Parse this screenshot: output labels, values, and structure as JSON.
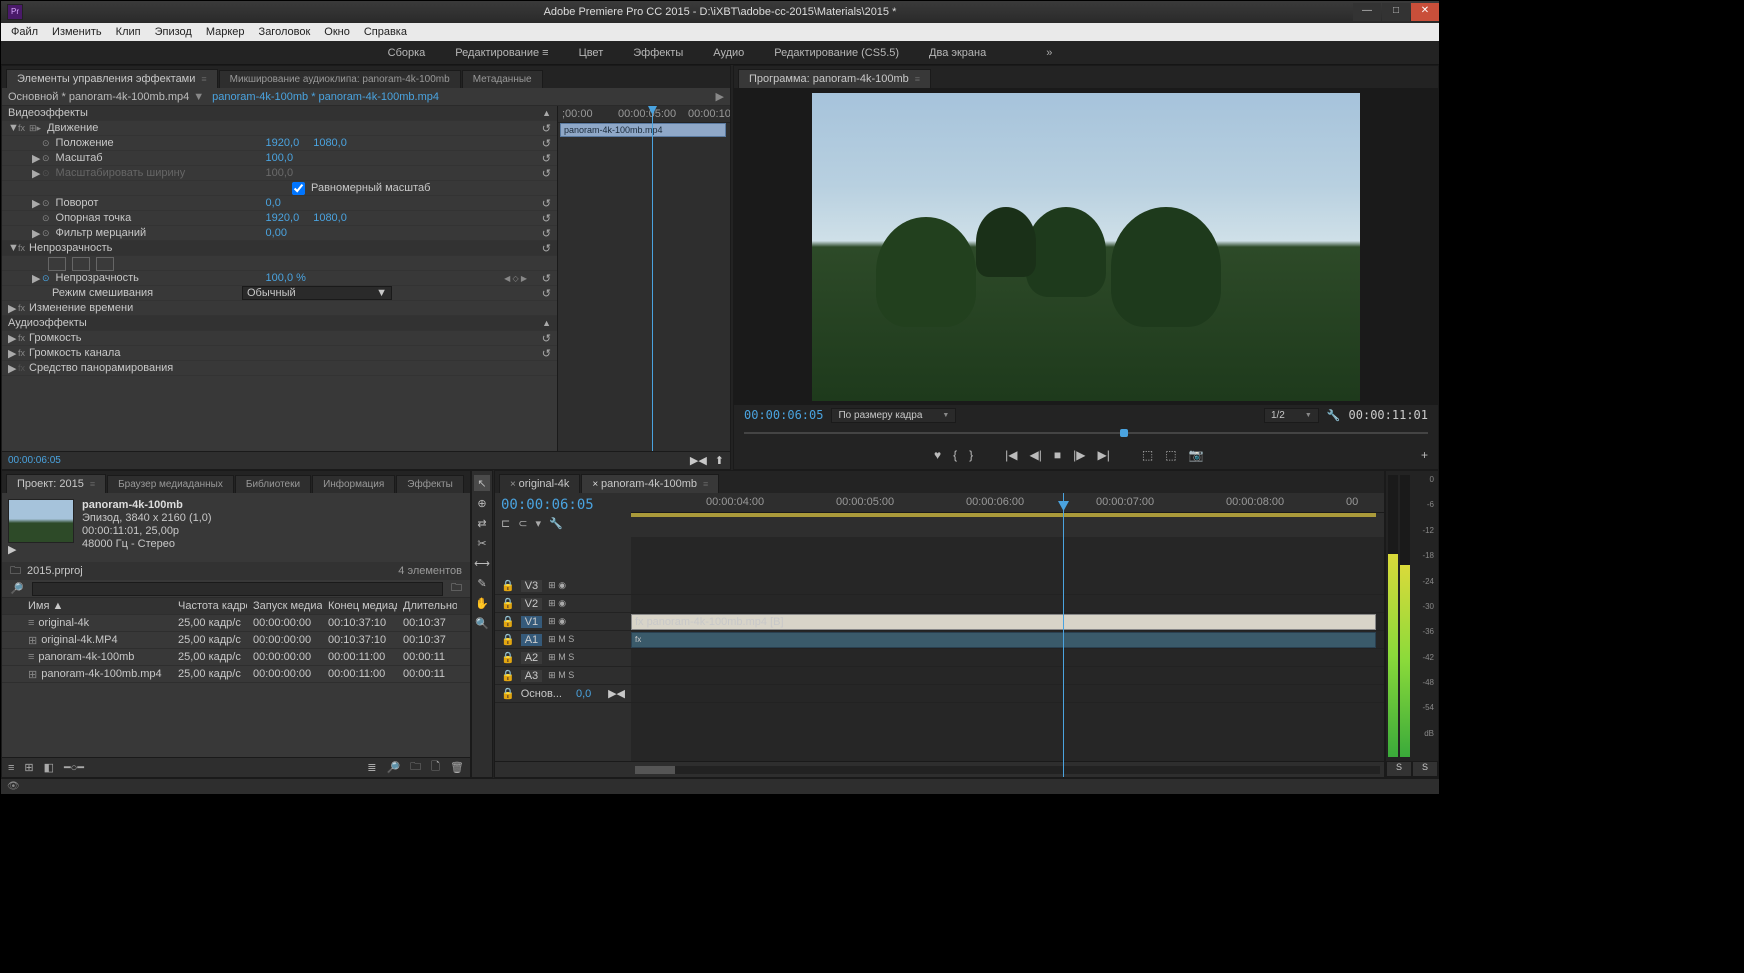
{
  "title": "Adobe Premiere Pro CC 2015 - D:\\iXBT\\adobe-cc-2015\\Materials\\2015 *",
  "menu": [
    "Файл",
    "Изменить",
    "Клип",
    "Эпизод",
    "Маркер",
    "Заголовок",
    "Окно",
    "Справка"
  ],
  "workspaces": {
    "items": [
      "Сборка",
      "Редактирование",
      "Цвет",
      "Эффекты",
      "Аудио",
      "Редактирование (CS5.5)",
      "Два экрана"
    ],
    "active": 1,
    "more": "»"
  },
  "effectControls": {
    "tabs": [
      "Элементы управления эффектами",
      "Микширование аудиоклипа: panoram-4k-100mb",
      "Метаданные"
    ],
    "source": "Основной * panoram-4k-100mb.mp4",
    "sequence": "panoram-4k-100mb * panoram-4k-100mb.mp4",
    "timeRuler": [
      ";00:00",
      "00:00:05:00",
      "00:00:10:"
    ],
    "clipLabel": "panoram-4k-100mb.mp4",
    "sections": {
      "videoEffects": "Видеоэффекты",
      "motion": "Движение",
      "position": "Положение",
      "positionVal": [
        "1920,0",
        "1080,0"
      ],
      "scale": "Масштаб",
      "scaleVal": "100,0",
      "scaleW": "Масштабировать ширину",
      "scaleWVal": "100,0",
      "uniform": "Равномерный масштаб",
      "rotation": "Поворот",
      "rotationVal": "0,0",
      "anchor": "Опорная точка",
      "anchorVal": [
        "1920,0",
        "1080,0"
      ],
      "flicker": "Фильтр мерцаний",
      "flickerVal": "0,00",
      "opacity": "Непрозрачность",
      "opacityProp": "Непрозрачность",
      "opacityVal": "100,0 %",
      "blend": "Режим смешивания",
      "blendVal": "Обычный",
      "timeRemap": "Изменение времени",
      "audioEffects": "Аудиоэффекты",
      "volume": "Громкость",
      "channelVol": "Громкость канала",
      "panner": "Средство панорамирования"
    },
    "timecode": "00:00:06:05"
  },
  "program": {
    "tab": "Программа: panoram-4k-100mb",
    "timecode": "00:00:06:05",
    "fit": "По размеру кадра",
    "zoom": "1/2",
    "duration": "00:00:11:01"
  },
  "project": {
    "tabs": [
      "Проект: 2015",
      "Браузер медиаданных",
      "Библиотеки",
      "Информация",
      "Эффекты"
    ],
    "clip": {
      "name": "panoram-4k-100mb",
      "line1": "Эпизод, 3840 x 2160 (1,0)",
      "line2": "00:00:11:01, 25,00p",
      "line3": "48000 Гц - Стерео"
    },
    "file": "2015.prproj",
    "count": "4 элементов",
    "search": "",
    "headers": [
      "",
      "Имя  ▲",
      "Частота кадров",
      "Запуск медиаданн",
      "Конец медиаданн",
      "Длительнос"
    ],
    "rows": [
      {
        "color": "#3a8a3a",
        "icon": "≡",
        "name": "original-4k",
        "fps": "25,00 кадр/с",
        "in": "00:00:00:00",
        "out": "00:10:37:10",
        "dur": "00:10:37"
      },
      {
        "color": "#4a6aaa",
        "icon": "⊞",
        "name": "original-4k.MP4",
        "fps": "25,00 кадр/с",
        "in": "00:00:00:00",
        "out": "00:10:37:10",
        "dur": "00:10:37"
      },
      {
        "color": "#3a8a3a",
        "icon": "≡",
        "name": "panoram-4k-100mb",
        "fps": "25,00 кадр/с",
        "in": "00:00:00:00",
        "out": "00:00:11:00",
        "dur": "00:00:11"
      },
      {
        "color": "#4a6aaa",
        "icon": "⊞",
        "name": "panoram-4k-100mb.mp4",
        "fps": "25,00 кадр/с",
        "in": "00:00:00:00",
        "out": "00:00:11:00",
        "dur": "00:00:11"
      }
    ]
  },
  "tools": [
    "↖",
    "⊕",
    "⇄",
    "✂",
    "⟷",
    "✎",
    "✋",
    "🔍"
  ],
  "timeline": {
    "tabs": [
      "original-4k",
      "panoram-4k-100mb"
    ],
    "activeTab": 1,
    "timecode": "00:00:06:05",
    "ruler": [
      "00:00:04:00",
      "00:00:05:00",
      "00:00:06:00",
      "00:00:07:00",
      "00:00:08:00",
      "00"
    ],
    "tracks": {
      "v3": "V3",
      "v2": "V2",
      "v1": "V1",
      "a1": "A1",
      "a2": "A2",
      "a3": "A3",
      "master": "Основ...",
      "masterVal": "0,0"
    },
    "clipName": "panoram-4k-100mb.mp4 [В]"
  },
  "meters": {
    "scale": [
      "0",
      "-6",
      "-12",
      "-18",
      "-24",
      "-30",
      "-36",
      "-42",
      "-48",
      "-54",
      "dB"
    ],
    "solo": "S"
  }
}
